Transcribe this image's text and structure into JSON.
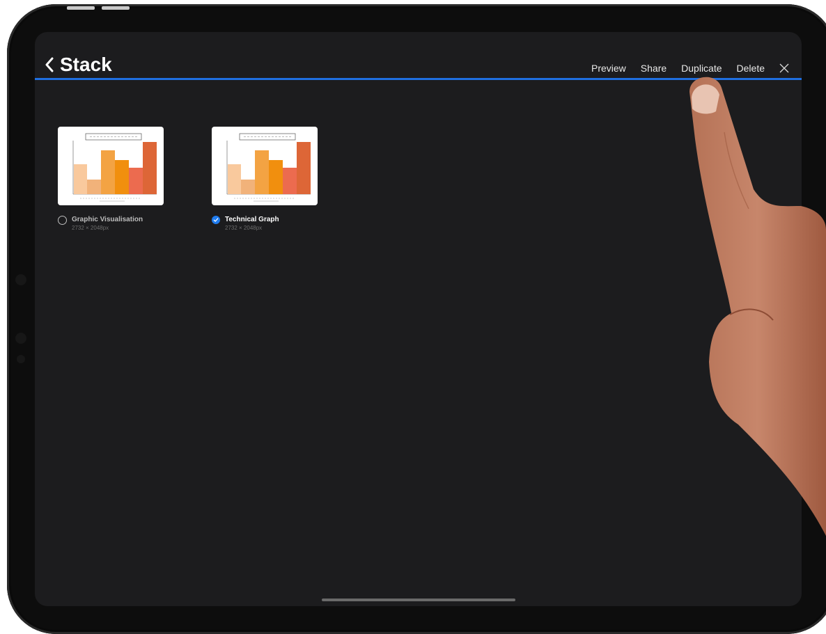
{
  "header": {
    "back_label": "Stack",
    "actions": {
      "preview": "Preview",
      "share": "Share",
      "duplicate": "Duplicate",
      "delete": "Delete"
    }
  },
  "items": [
    {
      "name": "Graphic Visualisation",
      "dimensions": "2732 × 2048px",
      "selected": false
    },
    {
      "name": "Technical Graph",
      "dimensions": "2732 × 2048px",
      "selected": true
    }
  ],
  "colors": {
    "accent": "#1f6fe0",
    "background": "#1c1c1e"
  }
}
